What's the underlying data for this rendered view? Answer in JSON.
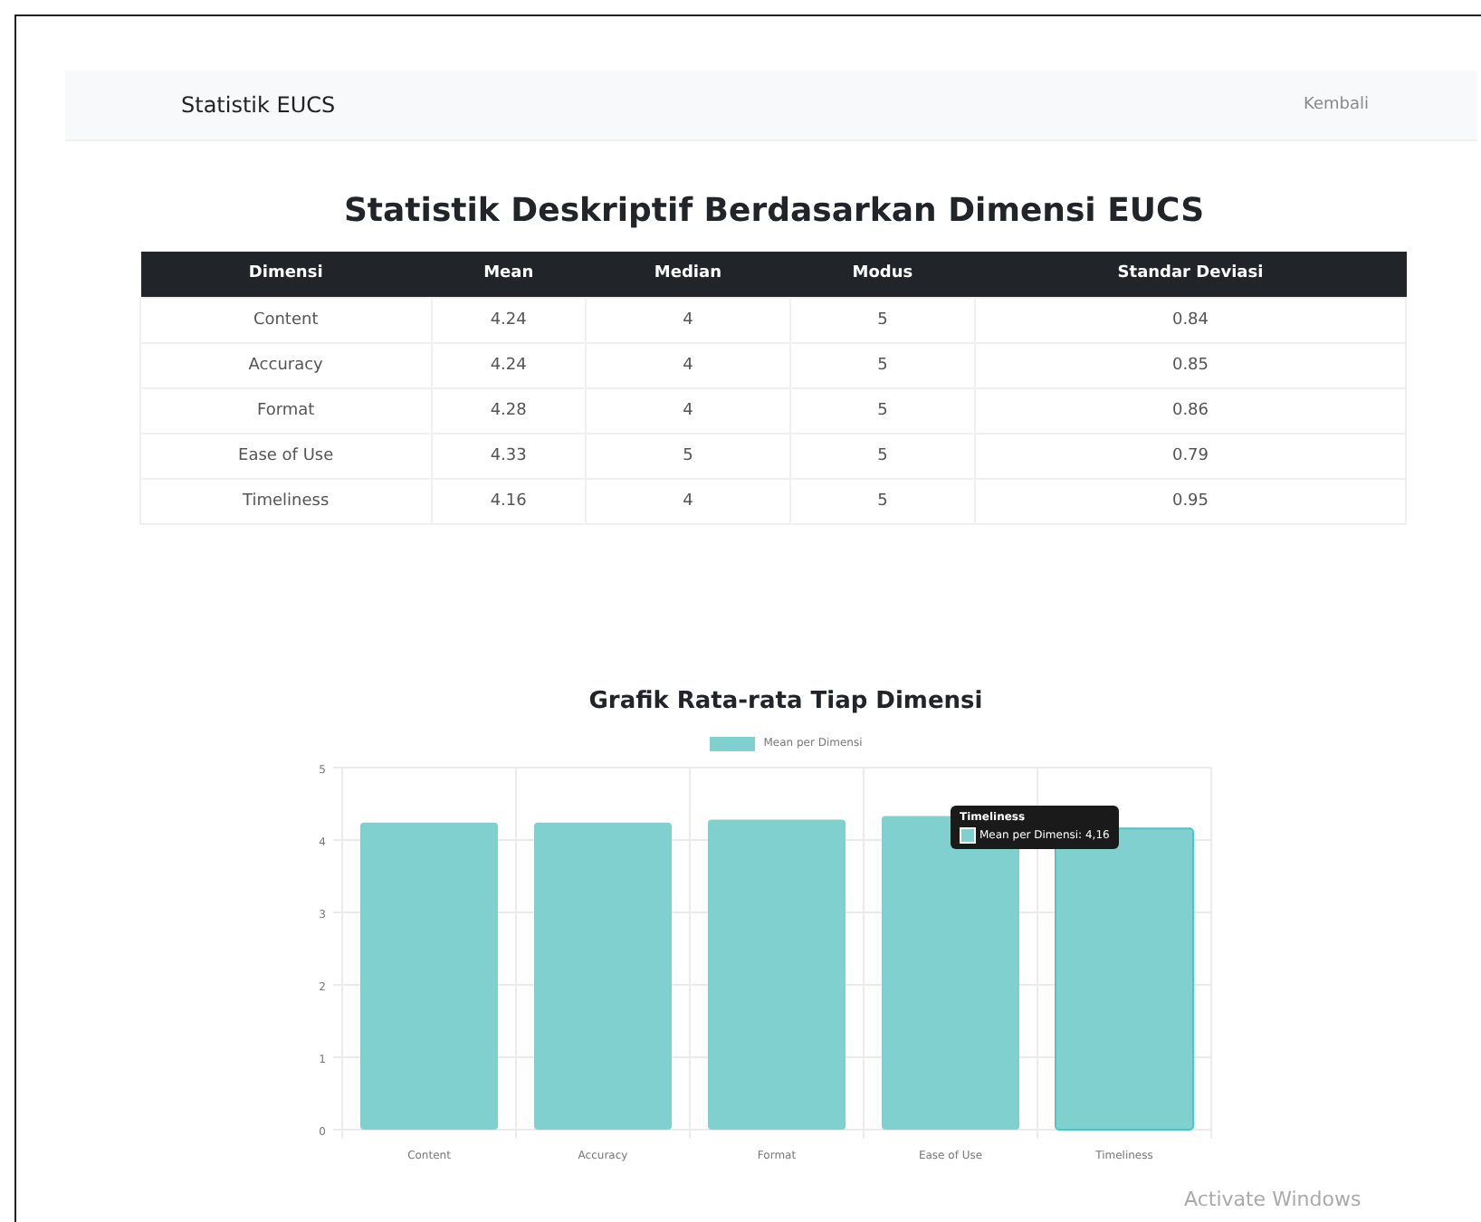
{
  "navbar": {
    "brand": "Statistik EUCS",
    "link": "Kembali"
  },
  "page_title": "Statistik Deskriptif Berdasarkan Dimensi EUCS",
  "table": {
    "columns": [
      "Dimensi",
      "Mean",
      "Median",
      "Modus",
      "Standar Deviasi"
    ],
    "rows": [
      [
        "Content",
        "4.24",
        "4",
        "5",
        "0.84"
      ],
      [
        "Accuracy",
        "4.24",
        "4",
        "5",
        "0.85"
      ],
      [
        "Format",
        "4.28",
        "4",
        "5",
        "0.86"
      ],
      [
        "Ease of Use",
        "4.33",
        "5",
        "5",
        "0.79"
      ],
      [
        "Timeliness",
        "4.16",
        "4",
        "5",
        "0.95"
      ]
    ]
  },
  "chart": {
    "chart_data": {
      "type": "bar",
      "title": "Grafik Rata-rata Tiap Dimensi",
      "categories": [
        "Content",
        "Accuracy",
        "Format",
        "Ease of Use",
        "Timeliness"
      ],
      "series": [
        {
          "name": "Mean per Dimensi",
          "color": "#80d0d0",
          "values": [
            4.24,
            4.24,
            4.28,
            4.33,
            4.16
          ]
        }
      ],
      "ylim": [
        0,
        5
      ],
      "yticks": [
        0,
        1,
        2,
        3,
        4,
        5
      ],
      "grid": true
    },
    "bars": [
      {
        "hovered": false
      },
      {
        "hovered": false
      },
      {
        "hovered": false
      },
      {
        "hovered": false
      },
      {
        "hovered": true
      }
    ],
    "tooltip": {
      "title": "Timeliness",
      "label": "Mean per Dimensi: 4,16"
    }
  },
  "os_notice": "Activate Windows"
}
